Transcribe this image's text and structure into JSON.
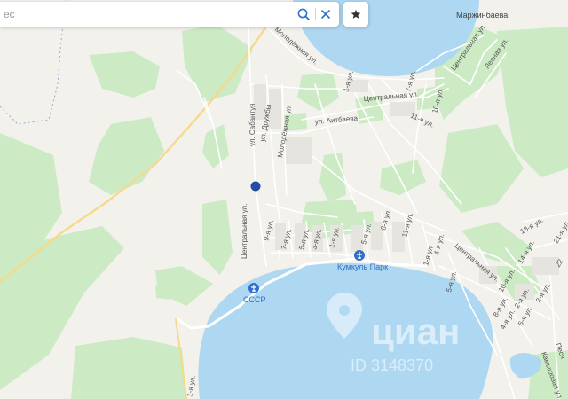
{
  "search": {
    "value": "",
    "placeholder": "ес"
  },
  "icons": {
    "search": "search-icon",
    "clear": "close-icon",
    "favorite": "star-icon",
    "poi": "airport-icon",
    "location": "location-pin-icon"
  },
  "colors": {
    "water": "#aed7f2",
    "forest": "#ccebc4",
    "land": "#f3f1ec",
    "road": "#ffffff",
    "major_road": "#f6d98a",
    "poi": "#2f6fc9",
    "marker": "#1e4fa3"
  },
  "places": {
    "village": "Маржинбаева"
  },
  "pois": [
    {
      "label": "Кумкуль Парк"
    },
    {
      "label": "СССР"
    }
  ],
  "streets": {
    "molodezhnaya_1": "Молодёжная ул.",
    "molodezhnaya_2": "Молодёжная ул.",
    "sabantuya": "ул. Сабантуя",
    "druzhby": "ул. Дружбы",
    "aitbaeva": "ул. Аитбаева",
    "centralnaya_1": "Центральная ул.",
    "centralnaya_2": "Центральная ул.",
    "centralnaya_3": "Центральная ул.",
    "centralnaya_4": "Центральная ул.",
    "lesnaya": "Лесная ул.",
    "kamyshovaya": "Камышовая ул.",
    "peschanaya": "Песч",
    "s1": "1-я ул.",
    "s1b": "1-я ул.",
    "s1c": "1-я ул.",
    "s2": "2-я ул.",
    "s2b": "2-я ул.",
    "s3": "3-я ул.",
    "s4": "4-я ул.",
    "s4b": "4-я ул.",
    "s5": "5-я ул.",
    "s5b": "5-я ул.",
    "s5c": "5-я ул.",
    "s7": "7-я ул.",
    "s7b": "7-я ул.",
    "s8": "8-я ул.",
    "s8b": "8-я ул.",
    "s9": "9-я ул.",
    "s10": "10-я ул.",
    "s10b": "10-я ул.",
    "s11": "11-я ул.",
    "s11b": "11-я ул.",
    "s14": "14-я ул.",
    "s18": "18-я ул.",
    "s21": "21-я ул.",
    "s22": "22"
  },
  "watermark": {
    "brand": "циан",
    "listing_id": "ID 3148370"
  }
}
